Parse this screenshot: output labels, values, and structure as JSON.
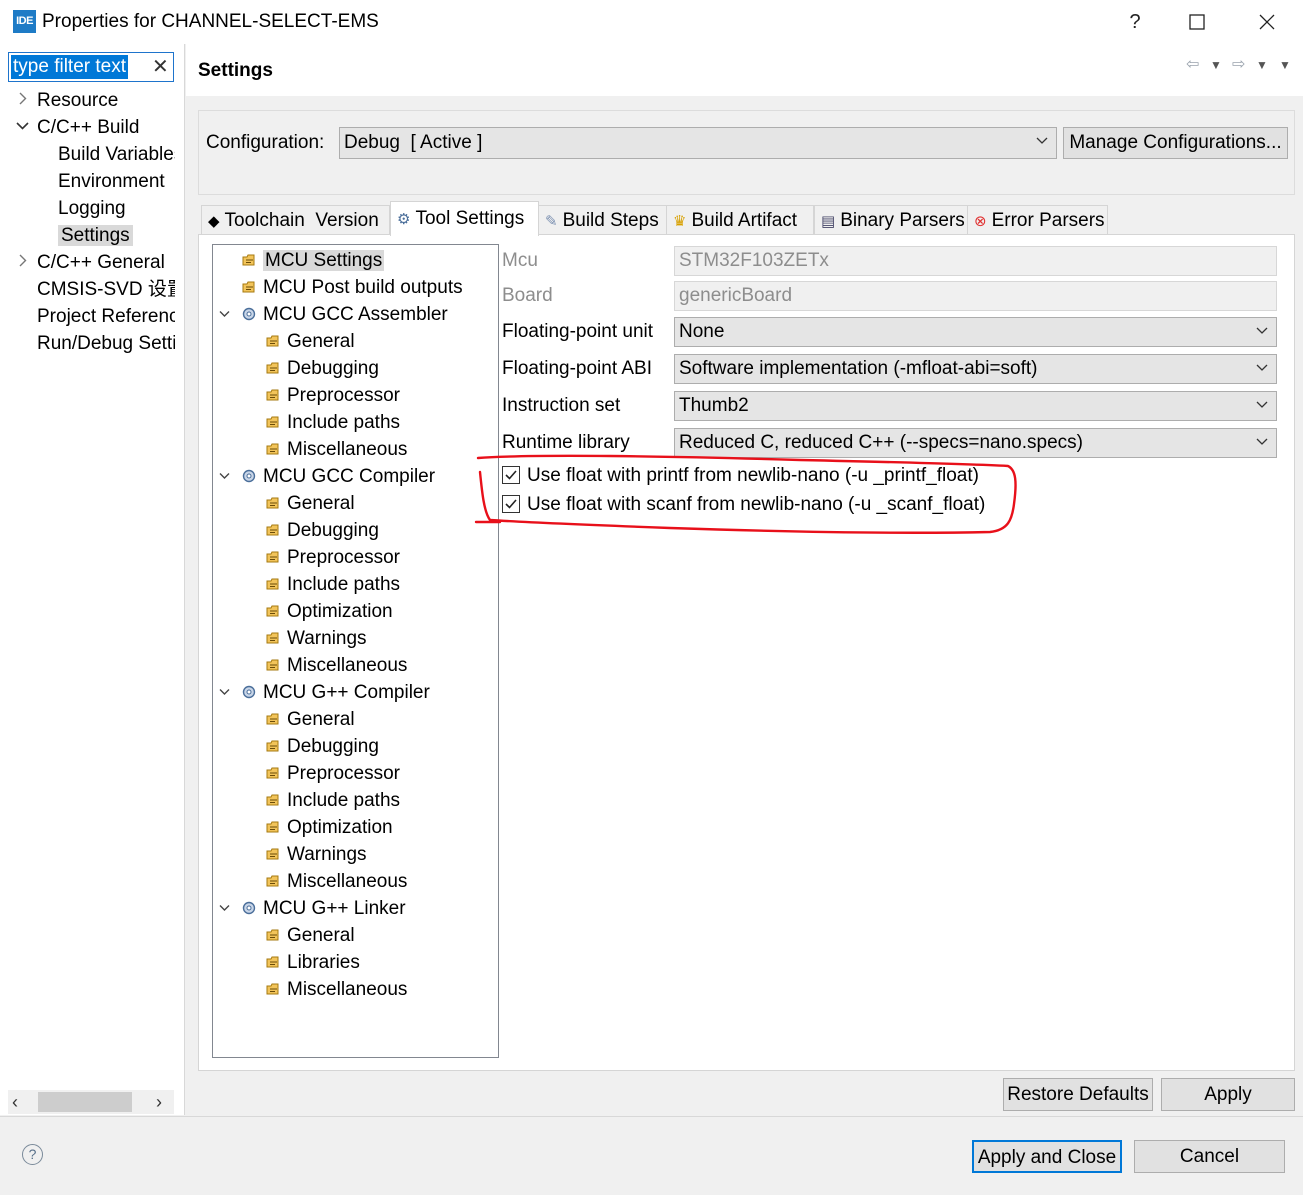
{
  "window": {
    "app_icon_text": "IDE",
    "title": "Properties for CHANNEL-SELECT-EMS",
    "help_glyph": "?"
  },
  "filter": {
    "text": "type filter text",
    "clear_glyph": "✕"
  },
  "nav": [
    {
      "label": "Resource",
      "expander": "collapsed",
      "depth": 0
    },
    {
      "label": "C/C++ Build",
      "expander": "expanded",
      "depth": 0
    },
    {
      "label": "Build Variables",
      "expander": "none",
      "depth": 1
    },
    {
      "label": "Environment",
      "expander": "none",
      "depth": 1
    },
    {
      "label": "Logging",
      "expander": "none",
      "depth": 1
    },
    {
      "label": "Settings",
      "expander": "none",
      "depth": 1,
      "selected": true
    },
    {
      "label": "C/C++ General",
      "expander": "collapsed",
      "depth": 0
    },
    {
      "label": "CMSIS-SVD 设置",
      "expander": "none",
      "depth": 0
    },
    {
      "label": "Project References",
      "expander": "none",
      "depth": 0
    },
    {
      "label": "Run/Debug Settings",
      "expander": "none",
      "depth": 0
    }
  ],
  "header": {
    "title": "Settings"
  },
  "configuration": {
    "label": "Configuration:",
    "value": "Debug  [ Active ]",
    "manage_label": "Manage Configurations..."
  },
  "tabs": [
    {
      "label": "Toolchain  Version",
      "icon": "toolchain-icon",
      "active": false
    },
    {
      "label": "Tool Settings",
      "icon": "gear-icon",
      "active": true
    },
    {
      "label": "Build Steps",
      "icon": "build-steps-icon",
      "active": false
    },
    {
      "label": "Build Artifact",
      "icon": "trophy-icon",
      "active": false
    },
    {
      "label": "Binary Parsers",
      "icon": "binary-icon",
      "active": false
    },
    {
      "label": "Error Parsers",
      "icon": "error-icon",
      "active": false
    }
  ],
  "tree": [
    {
      "label": "MCU Settings",
      "depth": 0,
      "expander": "none",
      "icon": "option-icon",
      "selected": true
    },
    {
      "label": "MCU Post build outputs",
      "depth": 0,
      "expander": "none",
      "icon": "option-icon"
    },
    {
      "label": "MCU GCC Assembler",
      "depth": 0,
      "expander": "expanded",
      "icon": "tool-icon"
    },
    {
      "label": "General",
      "depth": 1,
      "icon": "option-icon"
    },
    {
      "label": "Debugging",
      "depth": 1,
      "icon": "option-icon"
    },
    {
      "label": "Preprocessor",
      "depth": 1,
      "icon": "option-icon"
    },
    {
      "label": "Include paths",
      "depth": 1,
      "icon": "option-icon"
    },
    {
      "label": "Miscellaneous",
      "depth": 1,
      "icon": "option-icon"
    },
    {
      "label": "MCU GCC Compiler",
      "depth": 0,
      "expander": "expanded",
      "icon": "tool-icon"
    },
    {
      "label": "General",
      "depth": 1,
      "icon": "option-icon"
    },
    {
      "label": "Debugging",
      "depth": 1,
      "icon": "option-icon"
    },
    {
      "label": "Preprocessor",
      "depth": 1,
      "icon": "option-icon"
    },
    {
      "label": "Include paths",
      "depth": 1,
      "icon": "option-icon"
    },
    {
      "label": "Optimization",
      "depth": 1,
      "icon": "option-icon"
    },
    {
      "label": "Warnings",
      "depth": 1,
      "icon": "option-icon"
    },
    {
      "label": "Miscellaneous",
      "depth": 1,
      "icon": "option-icon"
    },
    {
      "label": "MCU G++ Compiler",
      "depth": 0,
      "expander": "expanded",
      "icon": "tool-icon"
    },
    {
      "label": "General",
      "depth": 1,
      "icon": "option-icon"
    },
    {
      "label": "Debugging",
      "depth": 1,
      "icon": "option-icon"
    },
    {
      "label": "Preprocessor",
      "depth": 1,
      "icon": "option-icon"
    },
    {
      "label": "Include paths",
      "depth": 1,
      "icon": "option-icon"
    },
    {
      "label": "Optimization",
      "depth": 1,
      "icon": "option-icon"
    },
    {
      "label": "Warnings",
      "depth": 1,
      "icon": "option-icon"
    },
    {
      "label": "Miscellaneous",
      "depth": 1,
      "icon": "option-icon"
    },
    {
      "label": "MCU G++ Linker",
      "depth": 0,
      "expander": "expanded",
      "icon": "tool-icon"
    },
    {
      "label": "General",
      "depth": 1,
      "icon": "option-icon"
    },
    {
      "label": "Libraries",
      "depth": 1,
      "icon": "option-icon"
    },
    {
      "label": "Miscellaneous",
      "depth": 1,
      "icon": "option-icon"
    }
  ],
  "form": {
    "mcu": {
      "label": "Mcu",
      "value": "STM32F103ZETx"
    },
    "board": {
      "label": "Board",
      "value": "genericBoard"
    },
    "fpu": {
      "label": "Floating-point unit",
      "value": "None"
    },
    "fabi": {
      "label": "Floating-point ABI",
      "value": "Software implementation (-mfloat-abi=soft)"
    },
    "iset": {
      "label": "Instruction set",
      "value": "Thumb2"
    },
    "rtlib": {
      "label": "Runtime library",
      "value": "Reduced C, reduced C++ (--specs=nano.specs)"
    },
    "printf_float": {
      "label": "Use float with printf from newlib-nano (-u _printf_float)",
      "checked": true
    },
    "scanf_float": {
      "label": "Use float with scanf from newlib-nano (-u _scanf_float)",
      "checked": true
    }
  },
  "buttons": {
    "restore": "Restore Defaults",
    "apply": "Apply",
    "apply_close": "Apply and Close",
    "cancel": "Cancel"
  },
  "colors": {
    "accent": "#0078d7",
    "annotation": "#e8101a",
    "selected_bg": "#d9d9d9"
  }
}
